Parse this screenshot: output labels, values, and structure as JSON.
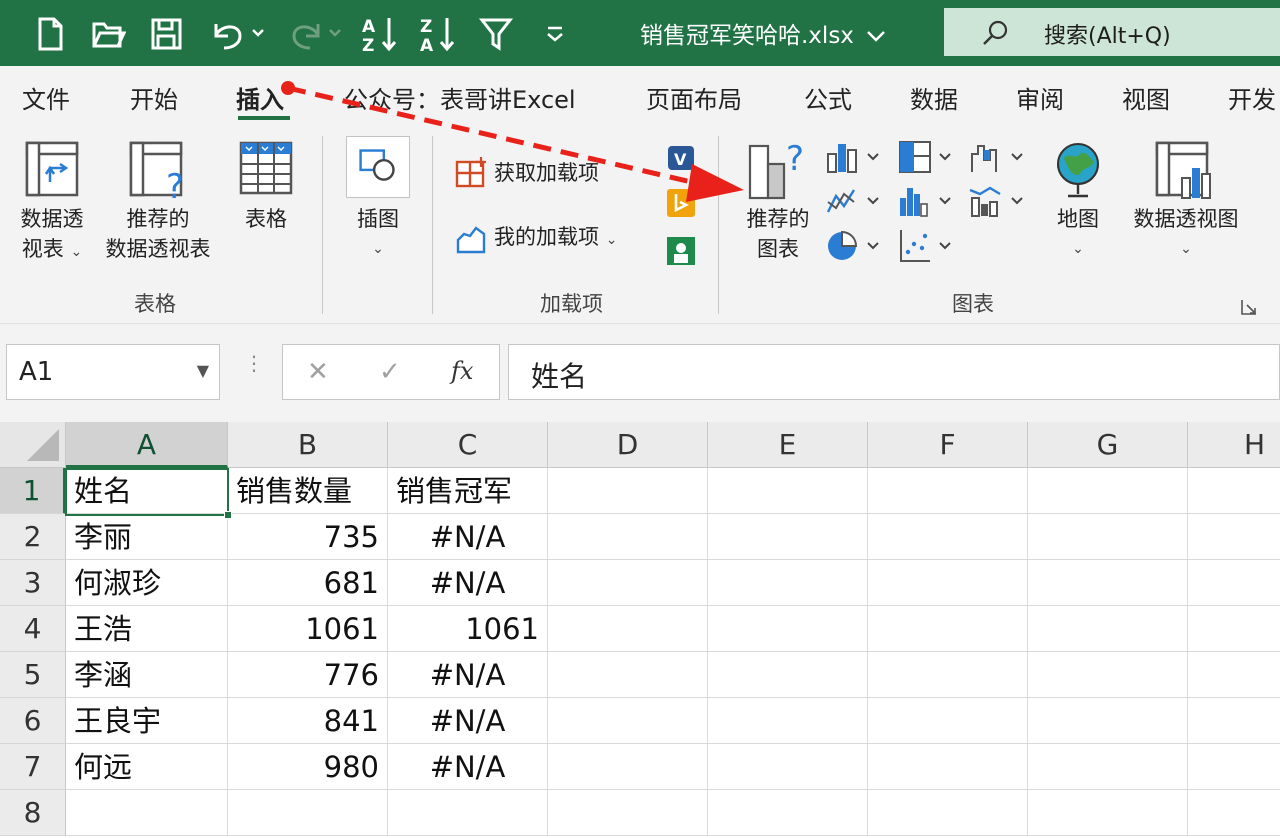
{
  "titlebar": {
    "doc_title": "销售冠军笑哈哈.xlsx",
    "search_label": "搜索(Alt+Q)",
    "quick_access_icons": [
      "new-file-icon",
      "open-folder-icon",
      "save-icon",
      "undo-icon",
      "redo-icon",
      "sort-ascending-icon",
      "sort-descending-icon",
      "filter-icon",
      "customize-qat-icon"
    ]
  },
  "tabs": [
    "文件",
    "开始",
    "插入",
    "公众号：表哥讲Excel",
    "页面布局",
    "公式",
    "数据",
    "审阅",
    "视图",
    "开发"
  ],
  "active_tab": "插入",
  "ribbon": {
    "groups": {
      "tables": {
        "label": "表格",
        "pivot_line1": "数据透",
        "pivot_line2": "视表",
        "recommended_pivot_line1": "推荐的",
        "recommended_pivot_line2": "数据透视表",
        "table": "表格"
      },
      "illustrations": {
        "label": "插图"
      },
      "addins": {
        "label": "加载项",
        "get_addins": "获取加载项",
        "my_addins": "我的加载项"
      },
      "charts": {
        "label": "图表",
        "recommended_line1": "推荐的",
        "recommended_line2": "图表",
        "maps": "地图",
        "pivot_chart": "数据透视图"
      }
    }
  },
  "formula_bar": {
    "name_box": "A1",
    "cancel_symbol": "✕",
    "enter_symbol": "✓",
    "fx_label": "fx",
    "content": "姓名"
  },
  "sheet": {
    "columns": [
      "A",
      "B",
      "C",
      "D",
      "E",
      "F",
      "G",
      "H"
    ],
    "rows": [
      "1",
      "2",
      "3",
      "4",
      "5",
      "6",
      "7",
      "8"
    ],
    "cells": [
      [
        "姓名",
        "销售数量",
        "销售冠军"
      ],
      [
        "李丽",
        "735",
        "#N/A"
      ],
      [
        "何淑珍",
        "681",
        "#N/A"
      ],
      [
        "王浩",
        "1061",
        "1061"
      ],
      [
        "李涵",
        "776",
        "#N/A"
      ],
      [
        "王良宇",
        "841",
        "#N/A"
      ],
      [
        "何远",
        "980",
        "#N/A"
      ],
      [
        "",
        "",
        ""
      ]
    ],
    "active_cell": "A1"
  },
  "colors": {
    "excel_green": "#217346",
    "annotation_red": "#e8221b"
  }
}
